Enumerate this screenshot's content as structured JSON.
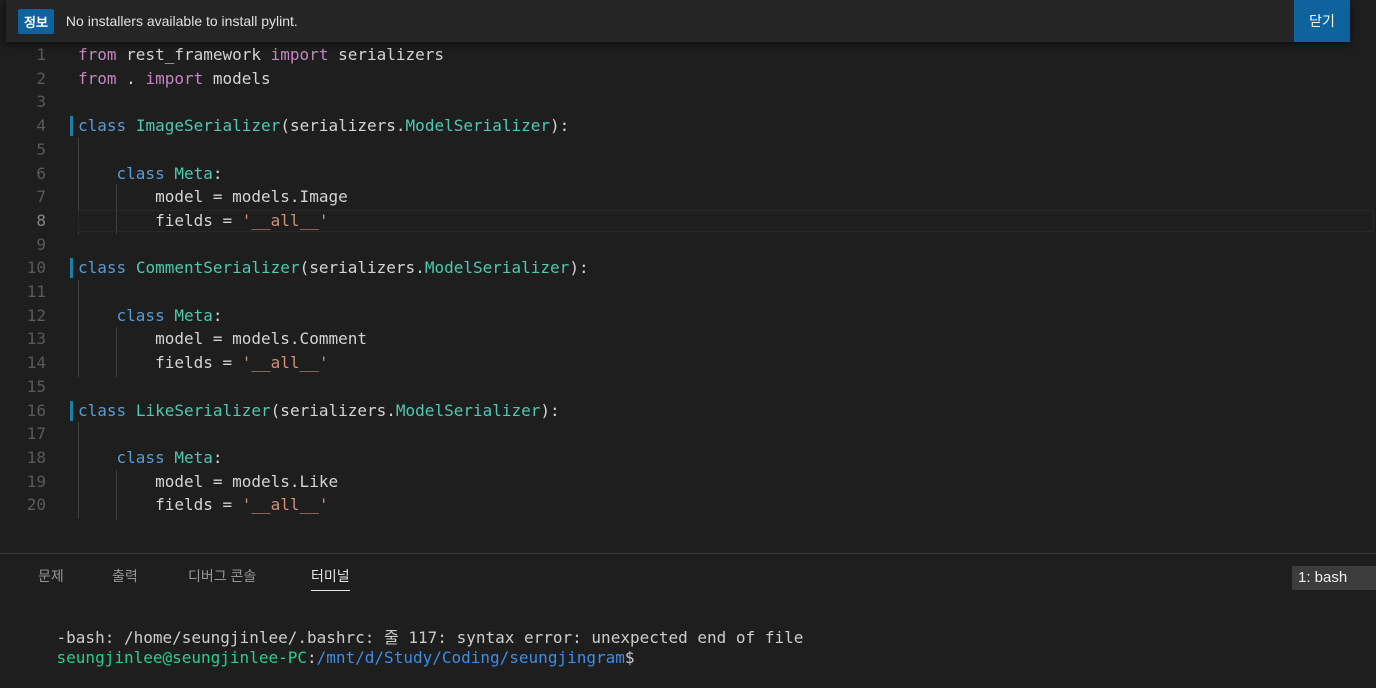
{
  "notification": {
    "badge": "정보",
    "message": "No installers available to install pylint.",
    "close_label": "닫기"
  },
  "editor": {
    "lines": [
      {
        "n": "1",
        "parts": [
          {
            "t": "from",
            "c": "kw"
          },
          {
            "t": " rest_framework ",
            "c": "pl"
          },
          {
            "t": "import",
            "c": "kw"
          },
          {
            "t": " serializers",
            "c": "pl"
          }
        ]
      },
      {
        "n": "2",
        "parts": [
          {
            "t": "from",
            "c": "kw"
          },
          {
            "t": " . ",
            "c": "pl"
          },
          {
            "t": "import",
            "c": "kw"
          },
          {
            "t": " models",
            "c": "pl"
          }
        ]
      },
      {
        "n": "3",
        "parts": []
      },
      {
        "n": "4",
        "mark": true,
        "parts": [
          {
            "t": "class",
            "c": "kwb"
          },
          {
            "t": " ",
            "c": "pl"
          },
          {
            "t": "ImageSerializer",
            "c": "cls"
          },
          {
            "t": "(serializers.",
            "c": "pl"
          },
          {
            "t": "ModelSerializer",
            "c": "cls"
          },
          {
            "t": "):",
            "c": "pl"
          }
        ]
      },
      {
        "n": "5",
        "parts": []
      },
      {
        "n": "6",
        "parts": [
          {
            "t": "    ",
            "c": "pl"
          },
          {
            "t": "class",
            "c": "kwb"
          },
          {
            "t": " ",
            "c": "pl"
          },
          {
            "t": "Meta",
            "c": "cls"
          },
          {
            "t": ":",
            "c": "pl"
          }
        ]
      },
      {
        "n": "7",
        "parts": [
          {
            "t": "        model = models.Image",
            "c": "pl"
          }
        ]
      },
      {
        "n": "8",
        "current": true,
        "parts": [
          {
            "t": "        fields = ",
            "c": "pl"
          },
          {
            "t": "'__all__'",
            "c": "str"
          }
        ]
      },
      {
        "n": "9",
        "parts": []
      },
      {
        "n": "10",
        "mark": true,
        "parts": [
          {
            "t": "class",
            "c": "kwb"
          },
          {
            "t": " ",
            "c": "pl"
          },
          {
            "t": "CommentSerializer",
            "c": "cls"
          },
          {
            "t": "(serializers.",
            "c": "pl"
          },
          {
            "t": "ModelSerializer",
            "c": "cls"
          },
          {
            "t": "):",
            "c": "pl"
          }
        ]
      },
      {
        "n": "11",
        "parts": []
      },
      {
        "n": "12",
        "parts": [
          {
            "t": "    ",
            "c": "pl"
          },
          {
            "t": "class",
            "c": "kwb"
          },
          {
            "t": " ",
            "c": "pl"
          },
          {
            "t": "Meta",
            "c": "cls"
          },
          {
            "t": ":",
            "c": "pl"
          }
        ]
      },
      {
        "n": "13",
        "parts": [
          {
            "t": "        model = models.Comment",
            "c": "pl"
          }
        ]
      },
      {
        "n": "14",
        "parts": [
          {
            "t": "        fields = ",
            "c": "pl"
          },
          {
            "t": "'__all__'",
            "c": "str"
          }
        ]
      },
      {
        "n": "15",
        "parts": []
      },
      {
        "n": "16",
        "mark": true,
        "parts": [
          {
            "t": "class",
            "c": "kwb"
          },
          {
            "t": " ",
            "c": "pl"
          },
          {
            "t": "LikeSerializer",
            "c": "cls"
          },
          {
            "t": "(serializers.",
            "c": "pl"
          },
          {
            "t": "ModelSerializer",
            "c": "cls"
          },
          {
            "t": "):",
            "c": "pl"
          }
        ]
      },
      {
        "n": "17",
        "parts": []
      },
      {
        "n": "18",
        "parts": [
          {
            "t": "    ",
            "c": "pl"
          },
          {
            "t": "class",
            "c": "kwb"
          },
          {
            "t": " ",
            "c": "pl"
          },
          {
            "t": "Meta",
            "c": "cls"
          },
          {
            "t": ":",
            "c": "pl"
          }
        ]
      },
      {
        "n": "19",
        "parts": [
          {
            "t": "        model = models.Like",
            "c": "pl"
          }
        ]
      },
      {
        "n": "20",
        "parts": [
          {
            "t": "        fields = ",
            "c": "pl"
          },
          {
            "t": "'__all__'",
            "c": "str"
          }
        ]
      }
    ]
  },
  "panel": {
    "tabs": [
      {
        "label": "문제",
        "active": false
      },
      {
        "label": "출력",
        "active": false
      },
      {
        "label": "디버그 콘솔",
        "active": false
      },
      {
        "label": "터미널",
        "active": true
      }
    ],
    "terminal_select": "1: bash",
    "terminal": {
      "line1": "-bash: /home/seungjinlee/.bashrc: 줄 117: syntax error: unexpected end of file",
      "prompt_user": "seungjinlee@seungjinlee-PC",
      "prompt_sep": ":",
      "prompt_path": "/mnt/d/Study/Coding/seungjingram",
      "prompt_end": "$"
    }
  },
  "colors": {
    "accent": "#0e639c",
    "keyword_import": "#c586c0",
    "keyword_class": "#569cd6",
    "class_name": "#4ec9b0",
    "string": "#ce9178",
    "terminal_user": "#23d18b",
    "terminal_path": "#3b8eea"
  }
}
